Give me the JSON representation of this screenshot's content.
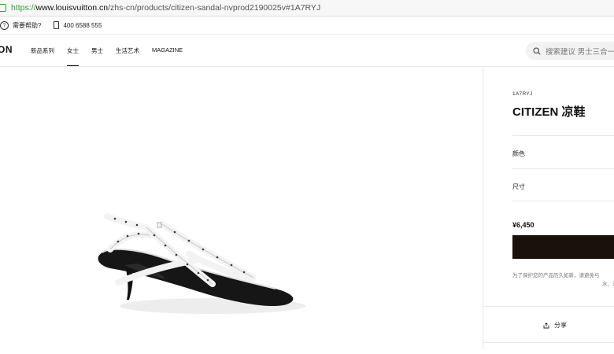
{
  "browser": {
    "url_scheme": "https://",
    "url_host": "www.louisvuitton.cn",
    "url_path": "/zhs-cn/products/citizen-sandal-nvprod2190025v#1A7RYJ"
  },
  "infobar": {
    "help_label": "需要帮助?",
    "phone": "400 6588 555"
  },
  "header": {
    "logo_text": "ON",
    "nav": [
      "新品系列",
      "女士",
      "男士",
      "生活艺术",
      "MAGAZINE"
    ],
    "search_placeholder": "搜索建议 男士三合一"
  },
  "product": {
    "sku": "1A7RYJ",
    "title": "CITIZEN 凉鞋",
    "color_label": "颜色",
    "size_label": "尺寸",
    "price": "¥6,450",
    "note_line1": "为了保护您的产品历久如新，请避免与",
    "note_line2": "水、汗",
    "share_label": "分享"
  },
  "colors": {
    "buy_button": "#19110b",
    "url_secure": "#2e9e36"
  }
}
